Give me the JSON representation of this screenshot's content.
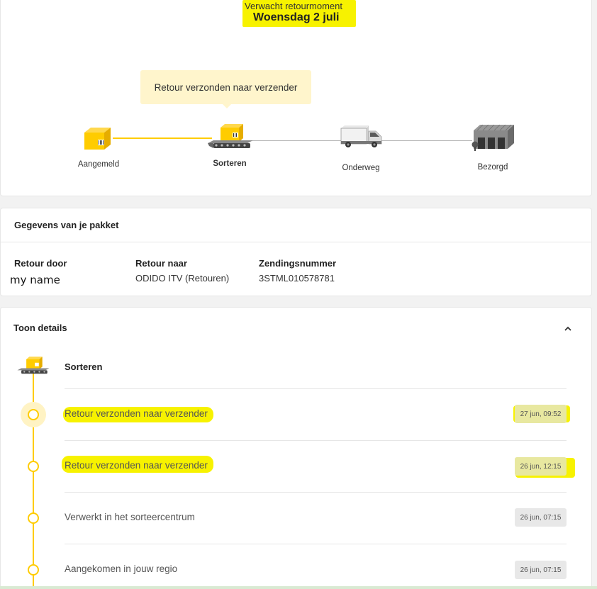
{
  "header": {
    "expected_label": "Verwacht retourmoment",
    "expected_date": "Woensdag 2 juli"
  },
  "tracker": {
    "tooltip": "Retour verzonden naar verzender",
    "steps": [
      {
        "label": "Aangemeld"
      },
      {
        "label": "Sorteren"
      },
      {
        "label": "Onderweg"
      },
      {
        "label": "Bezorgd"
      }
    ]
  },
  "package": {
    "title": "Gegevens van je pakket",
    "columns": [
      {
        "title": "Retour door",
        "value": "my name"
      },
      {
        "title": "Retour naar",
        "value": "ODIDO ITV (Retouren)"
      },
      {
        "title": "Zendingsnummer",
        "value": "3STML010578781"
      }
    ]
  },
  "details": {
    "title": "Toon details",
    "current_step": "Sorteren",
    "events": [
      {
        "text": "Retour verzonden naar verzender",
        "time": "27 jun, 09:52"
      },
      {
        "text": "Retour verzonden naar verzender",
        "time": "26 jun, 12:15"
      },
      {
        "text": "Verwerkt in het sorteercentrum",
        "time": "26 jun, 07:15"
      },
      {
        "text": "Aangekomen in jouw regio",
        "time": "26 jun, 07:15"
      }
    ]
  },
  "colors": {
    "accent": "#ffcc00",
    "highlight": "#f7f200",
    "tooltip_bg": "#fff5cc"
  }
}
